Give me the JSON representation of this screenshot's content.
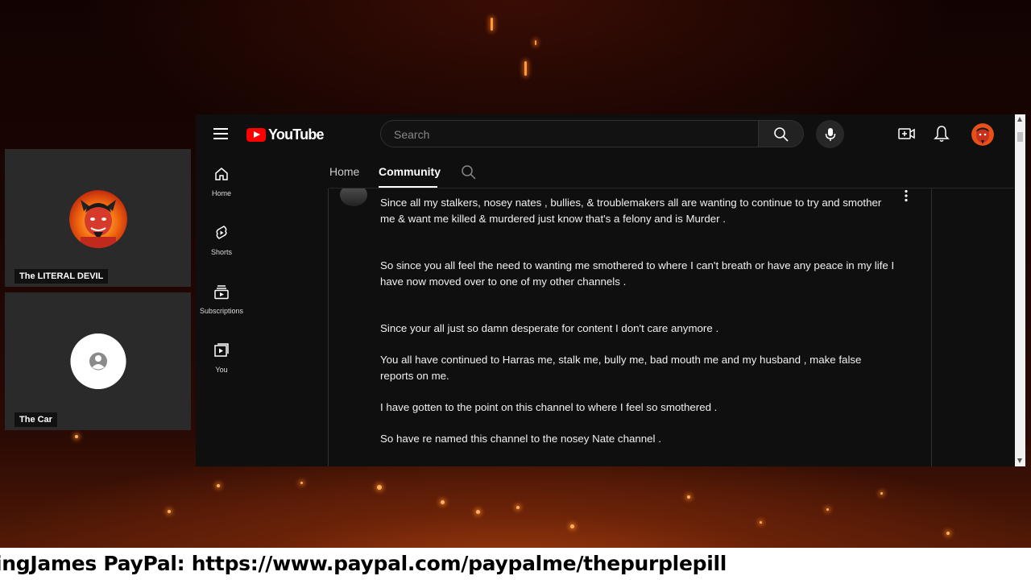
{
  "participants": [
    {
      "name": "The LITERAL DEVIL"
    },
    {
      "name": "The Car"
    }
  ],
  "youtube": {
    "logo_text": "YouTube",
    "search_placeholder": "Search",
    "sidebar": [
      {
        "label": "Home",
        "icon": "home-icon"
      },
      {
        "label": "Shorts",
        "icon": "shorts-icon"
      },
      {
        "label": "Subscriptions",
        "icon": "subscriptions-icon"
      },
      {
        "label": "You",
        "icon": "you-icon"
      }
    ],
    "tabs": [
      {
        "label": "Home",
        "active": false
      },
      {
        "label": "Community",
        "active": true
      }
    ],
    "post": {
      "paragraphs": [
        "Since all my stalkers, nosey nates , bullies, & troublemakers all are wanting to continue to try and smother me & want me killed & murdered just know that's a felony and is Murder .",
        "So since you all feel the need to wanting  me smothered to where I can't breath or have any peace in my life I have now moved over to one of my other channels .",
        "Since your all just so damn desperate for content I don't care anymore .",
        "You all have continued to Harras me, stalk me, bully me, bad mouth me and my husband , make false reports on me.",
        "I have gotten to the point on this channel  to where I feel so smothered .",
        "So have re named this channel to the nosey Nate channel ."
      ]
    }
  },
  "ticker": {
    "text": "ingJames PayPal: https://www.paypal.com/paypalme/thepurplepill"
  },
  "colors": {
    "youtube_red": "#ff0000",
    "window_bg": "#0f0f0f",
    "ticker_bg": "#ffffff"
  }
}
